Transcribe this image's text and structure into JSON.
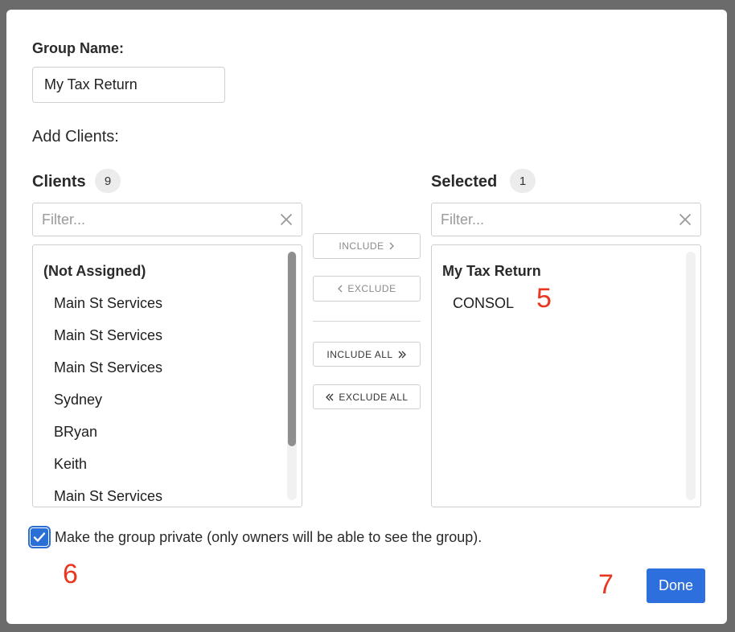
{
  "group": {
    "name_label": "Group Name:",
    "name_value": "My Tax Return"
  },
  "add_clients_label": "Add Clients:",
  "clients": {
    "title": "Clients",
    "count": "9",
    "filter_placeholder": "Filter...",
    "group_header": "(Not Assigned)",
    "items": [
      "Main St Services",
      "Main St Services",
      "Main St Services",
      "Sydney",
      "BRyan",
      "Keith",
      "Main St Services"
    ],
    "scroll_position": 0
  },
  "selected": {
    "title": "Selected",
    "count": "1",
    "filter_placeholder": "Filter...",
    "group_header": "My Tax Return",
    "items": [
      "CONSOL"
    ]
  },
  "buttons": {
    "include": "INCLUDE",
    "exclude": "EXCLUDE",
    "include_all": "INCLUDE ALL",
    "exclude_all": "EXCLUDE ALL",
    "done": "Done"
  },
  "icons": {
    "include": "chevron-right-icon",
    "exclude": "chevron-left-icon",
    "include_all": "double-chevron-right-icon",
    "exclude_all": "double-chevron-left-icon",
    "clear": "close-icon",
    "checkbox": "checkmark-icon"
  },
  "private_option": {
    "checked": true,
    "label": "Make the group private (only owners will be able to see the group)."
  },
  "annotations": [
    "5",
    "6",
    "7"
  ],
  "colors": {
    "primary": "#2d6fdc",
    "annotation": "#e8361f",
    "overlay": "#6b6b6b"
  }
}
